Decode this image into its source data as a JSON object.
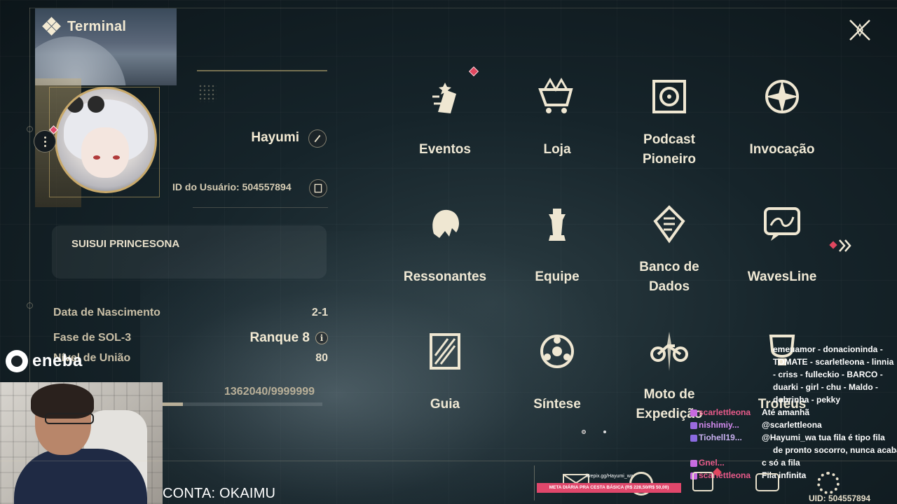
{
  "app": {
    "title": "Terminal"
  },
  "profile": {
    "username": "Hayumi",
    "user_id_label": "ID do Usuário: 504557894",
    "signature": "SUISUI PRINCESONA",
    "stats": [
      {
        "label": "Data de Nascimento",
        "value": "2-1"
      },
      {
        "label": "Fase de SOL-3",
        "value": "Ranque 8"
      },
      {
        "label": "Nível de União",
        "value": "80"
      }
    ],
    "exp_text": "1362040/9999999",
    "exp_fraction": 0.136
  },
  "menu": [
    {
      "label": "Eventos",
      "icon": "events-icon",
      "has_badge": true
    },
    {
      "label": "Loja",
      "icon": "shop-cart-icon"
    },
    {
      "label": "Podcast\nPioneiro",
      "icon": "podcast-icon"
    },
    {
      "label": "Invocação",
      "icon": "convene-icon"
    },
    {
      "label": "Ressonantes",
      "icon": "resonators-icon"
    },
    {
      "label": "Equipe",
      "icon": "team-chess-icon"
    },
    {
      "label": "Banco de\nDados",
      "icon": "databank-icon"
    },
    {
      "label": "WavesLine",
      "icon": "wavesline-icon"
    },
    {
      "label": "Guia",
      "icon": "guide-icon"
    },
    {
      "label": "Síntese",
      "icon": "synthesis-icon"
    },
    {
      "label": "Moto de\nExpedição",
      "icon": "expedition-moto-icon"
    },
    {
      "label": "Troféus",
      "icon": "trophies-icon"
    }
  ],
  "pagination": {
    "pages": 2,
    "current": 1
  },
  "stream": {
    "sponsor": "eneba",
    "account_caption": "CONTA: OKAIMU",
    "overlay_url": "livepix.gg/Hayumi_wa",
    "goal_banner": "META DIÁRIA PRA CESTA BÁSICA (R$ 228,50/R$ 50,00)",
    "chat": [
      {
        "user": "",
        "text": "emeuamor - donacioninda -"
      },
      {
        "user": "",
        "text": "TOMATE - scarletleona - linnia"
      },
      {
        "user": "",
        "text": "- criss - fulleckio - BARCO -"
      },
      {
        "user": "",
        "text": "duarki - girl - chu - Maldo -"
      },
      {
        "user": "",
        "text": "dobrinha - pekky"
      },
      {
        "user": "scarlettleona",
        "text": "Até amanhã",
        "color": "pink"
      },
      {
        "user": "nishimiy...",
        "text": "@scarlettleona",
        "color": "purple"
      },
      {
        "user": "Tiohell19...",
        "text": "@Hayumi_wa tua fila é tipo fila",
        "color": "lilac"
      },
      {
        "user": "",
        "text": "de pronto socorro, nunca acaba"
      },
      {
        "user": "Gnel...",
        "text": "c só a fila",
        "color": "pink"
      },
      {
        "user": "scarlettleona",
        "text": "Fila infinita",
        "color": "pink"
      }
    ]
  },
  "footer": {
    "uid": "UID: 504557894"
  },
  "colors": {
    "accent_gold": "#c9a96a",
    "badge_red": "#e0475f",
    "text_cream": "#f0e9d5"
  }
}
